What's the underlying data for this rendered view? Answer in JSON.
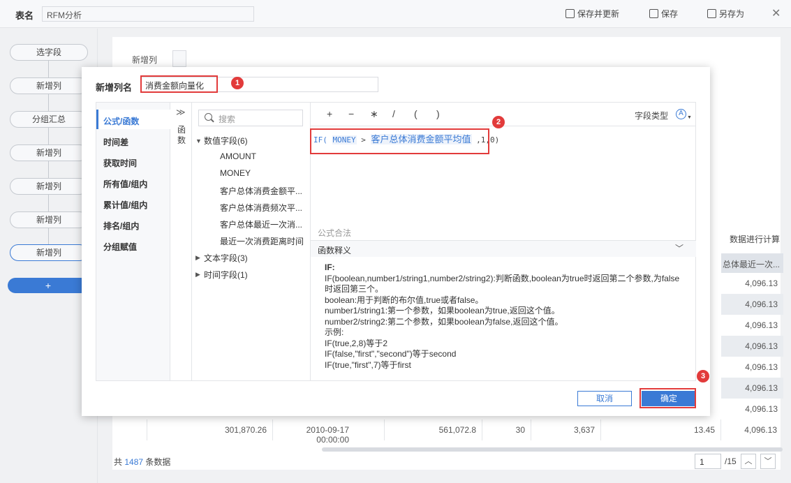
{
  "topbar": {
    "table_label": "表名",
    "table_name": "RFM分析",
    "save_update": "保存并更新",
    "save": "保存",
    "save_as": "另存为"
  },
  "steps": [
    "选字段",
    "新增列",
    "分组汇总",
    "新增列",
    "新增列",
    "新增列",
    "新增列"
  ],
  "add_step": "+",
  "main": {
    "new_col_label": "新增列",
    "calc_label": "数据进行计算",
    "column_header": "总体最近一次...",
    "column_values": [
      "4,096.13",
      "4,096.13",
      "4,096.13",
      "4,096.13",
      "4,096.13",
      "4,096.13",
      "4,096.13",
      "4,096.13"
    ],
    "last_row": [
      "301,870.26",
      "2010-09-17 00:00:00",
      "561,072.8",
      "30",
      "3,637",
      "13.45",
      "4,096.13"
    ],
    "footer_prefix": "共",
    "footer_count": "1487",
    "footer_suffix": "条数据",
    "page_current": "1",
    "page_total": "/15"
  },
  "dialog": {
    "name_label": "新增列名",
    "name_value": "消费金额向量化",
    "categories": [
      "公式/函数",
      "时间差",
      "获取时间",
      "所有值/组内",
      "累计值/组内",
      "排名/组内",
      "分组赋值"
    ],
    "fn_label": "函数",
    "search_placeholder": "搜索",
    "tree": {
      "numeric": "数值字段(6)",
      "numeric_fields": [
        "AMOUNT",
        "MONEY",
        "客户总体消费金额平...",
        "客户总体消费频次平...",
        "客户总体最近一次消...",
        "最近一次消费距离时间"
      ],
      "text": "文本字段(3)",
      "time": "时间字段(1)"
    },
    "operators": [
      "+",
      "−",
      "∗",
      "/",
      "(",
      ")"
    ],
    "field_type_label": "字段类型",
    "formula": {
      "fn": "IF(",
      "field1": "MONEY",
      "op": ">",
      "field2": "客户总体消费金额平均值",
      "rest": ",1,0)"
    },
    "legal_label": "公式合法",
    "explain_label": "函数释义",
    "doc": {
      "title": "IF:",
      "lines": [
        "IF(boolean,number1/string1,number2/string2):判断函数,boolean为true时返回第二个参数,为false时返回第三个。",
        "boolean:用于判断的布尔值,true或者false。",
        "number1/string1:第一个参数，如果boolean为true,返回这个值。",
        "number2/string2:第二个参数，如果boolean为false,返回这个值。",
        "示例:",
        "IF(true,2,8)等于2",
        "IF(false,\"first\",\"second\")等于second",
        "IF(true,\"first\",7)等于first"
      ]
    },
    "cancel": "取消",
    "ok": "确定",
    "badges": [
      "1",
      "2",
      "3"
    ]
  },
  "colors": {
    "accent": "#3a7ad5",
    "annotation": "#e23b3b"
  }
}
